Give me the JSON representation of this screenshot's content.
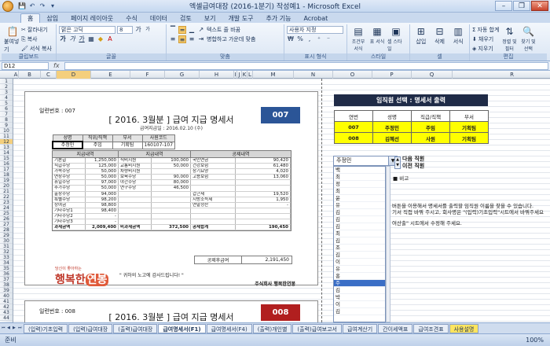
{
  "window": {
    "title": "엑셀급여대장 (2016-1분기) 작성예1 - Microsoft Excel",
    "minimize": "–",
    "restore": "❐",
    "close": "✕"
  },
  "qat": [
    "💾",
    "↶",
    "↷",
    "▾"
  ],
  "tabs": [
    "홈",
    "삽입",
    "페이지 레이아웃",
    "수식",
    "데이터",
    "검토",
    "보기",
    "개발 도구",
    "추가 기능",
    "Acrobat"
  ],
  "ribbon": {
    "clipboard": {
      "paste": "붙여넣기",
      "cut": "잘라내기",
      "copy": "복사",
      "format_painter": "서식 복사",
      "label": "클립보드"
    },
    "font": {
      "name": "맑은 고딕",
      "size": "8",
      "label": "글꼴",
      "grow": "가",
      "shrink": "가"
    },
    "align": {
      "wrap": "텍스트 줄 바꿈",
      "merge": "병합하고 가운데 맞춤",
      "label": "맞춤"
    },
    "number": {
      "format": "사용자 지정",
      "label": "표시 형식"
    },
    "styles": {
      "cond": "조건부 서식",
      "table": "표 서식",
      "cell": "셀 스타일",
      "label": "스타일"
    },
    "cells": {
      "insert": "삽입",
      "delete": "삭제",
      "format": "서식",
      "label": "셀"
    },
    "edit": {
      "autosum": "자동 합계",
      "fill": "채우기",
      "clear": "지우기",
      "sort": "정렬 및 필터",
      "find": "찾기 및 선택",
      "label": "편집"
    }
  },
  "formula_bar": {
    "cell": "D12",
    "fx": "fx",
    "value": ""
  },
  "columns": [
    "A",
    "B",
    "C",
    "D",
    "E",
    "F",
    "G",
    "H",
    "I",
    "J",
    "K",
    "L",
    "M",
    "N",
    "O",
    "P",
    "Q",
    "R"
  ],
  "rows": [
    "1",
    "2",
    "3",
    "4",
    "5",
    "6",
    "7",
    "8",
    "9",
    "10",
    "11",
    "12",
    "13",
    "14",
    "15",
    "16",
    "17",
    "18",
    "19",
    "20",
    "21",
    "22",
    "23",
    "24",
    "25",
    "26",
    "27",
    "28",
    "29",
    "30",
    "31",
    "32",
    "33",
    "34",
    "35",
    "36",
    "37",
    "38",
    "39",
    "40",
    "41",
    "42",
    "43",
    "44"
  ],
  "slip1": {
    "issue_no": "일련번호 : 007",
    "title": "[ 2016. 3월분 ] 급여 지급 명세서",
    "pay_date": "급여지급일 : 2016.02.10 (수)",
    "badge": "007",
    "emp_headers": [
      "성명",
      "직위/직책",
      "부서",
      "사원코드"
    ],
    "emp_values": [
      "주정민",
      "주임",
      "기획팀",
      "160107-107"
    ],
    "pay_headers": [
      "지급내역",
      "지급내역",
      "공제내역"
    ],
    "pay_rows": [
      [
        "기본급",
        "1,250,000",
        "식비지원",
        "100,000",
        "국민연금",
        "90,420"
      ],
      [
        "직급수당",
        "125,000",
        "교통비지원",
        "50,000",
        "건강보험",
        "61,480"
      ],
      [
        "가족수당",
        "50,000",
        "차량비지원",
        "",
        "장기요양",
        "4,020"
      ],
      [
        "연장수당",
        "50,000",
        "보육수당",
        "90,000",
        "고용보험",
        "13,060"
      ],
      [
        "휴일수당",
        "97,000",
        "야간수당",
        "80,000",
        "",
        ""
      ],
      [
        "추가수당",
        "50,000",
        "연구수당",
        "46,500",
        "",
        ""
      ],
      [
        "출장수당",
        "94,000",
        "",
        "",
        "갑근세",
        "19,520"
      ],
      [
        "특별수당",
        "98,200",
        "",
        "",
        "지방소득세",
        "1,950"
      ],
      [
        "상여금",
        "98,800",
        "",
        "",
        "연말정산",
        "-"
      ],
      [
        "기타수당1",
        "98,400",
        "",
        "",
        "",
        ""
      ],
      [
        "기타수당2",
        "-",
        "",
        "",
        "",
        ""
      ],
      [
        "기타수당3",
        "-",
        "",
        "",
        "",
        ""
      ],
      [
        "과세금액",
        "2,009,400",
        "비과세금액",
        "372,500",
        "공제합계",
        "190,450"
      ]
    ],
    "net_label": "공제후급여",
    "net_value": "2,191,450",
    "logo_small": "당신이 좋아하는",
    "logo_text": "행복한",
    "logo_em": "연봉",
    "thanks": "\" 귀하의 노고에 감사드립니다! \"",
    "company": "주식회사 행복한연봉"
  },
  "slip2": {
    "issue_no": "일련번호 : 008",
    "title": "[ 2016. 3월분 ] 급여 지급 명세서",
    "badge": "008"
  },
  "panel": {
    "title": "임직원 선택 : 명세서 출력",
    "headers": [
      "연번",
      "성명",
      "직급/직책",
      "부서"
    ],
    "rows": [
      [
        "007",
        "주정민",
        "주임",
        "기획팀"
      ],
      [
        "008",
        "김혜선",
        "사원",
        "기획팀"
      ]
    ],
    "dropdown_value": "주정민",
    "dropdown_list": [
      "백",
      "최",
      "정",
      "최",
      "윤",
      "유",
      "김",
      "김",
      "김",
      "최",
      "김",
      "조",
      "김",
      "이",
      "유",
      "홍",
      "주",
      "김",
      "박",
      "이",
      "김"
    ],
    "dropdown_arrow": "▼",
    "next": "다음 직원",
    "prev": "이전 직원",
    "note0": "■ 비고",
    "note1": "버튼을 이용해서 명세서를 출력할 임직원 이름을 찾을 수 있습니다.",
    "note2": "기서 직접 바꿔 주시고, 회사명은 \"(입력)기초입력\"시트에서 바꿔주세요",
    "note3": "여산출\" 시트에서 수정해 주세요."
  },
  "sheet_tabs": [
    "(입력)기초입력",
    "(입력)급여대장",
    "(출력)급여대장",
    "급여명세서(F1)",
    "급여명세서(F4)",
    "(출력)개인별",
    "(출력)급여보고서",
    "급여계산기",
    "간이세액표",
    "급여조견표",
    "사용설명"
  ],
  "status": {
    "ready": "준비",
    "zoom": "100%"
  }
}
